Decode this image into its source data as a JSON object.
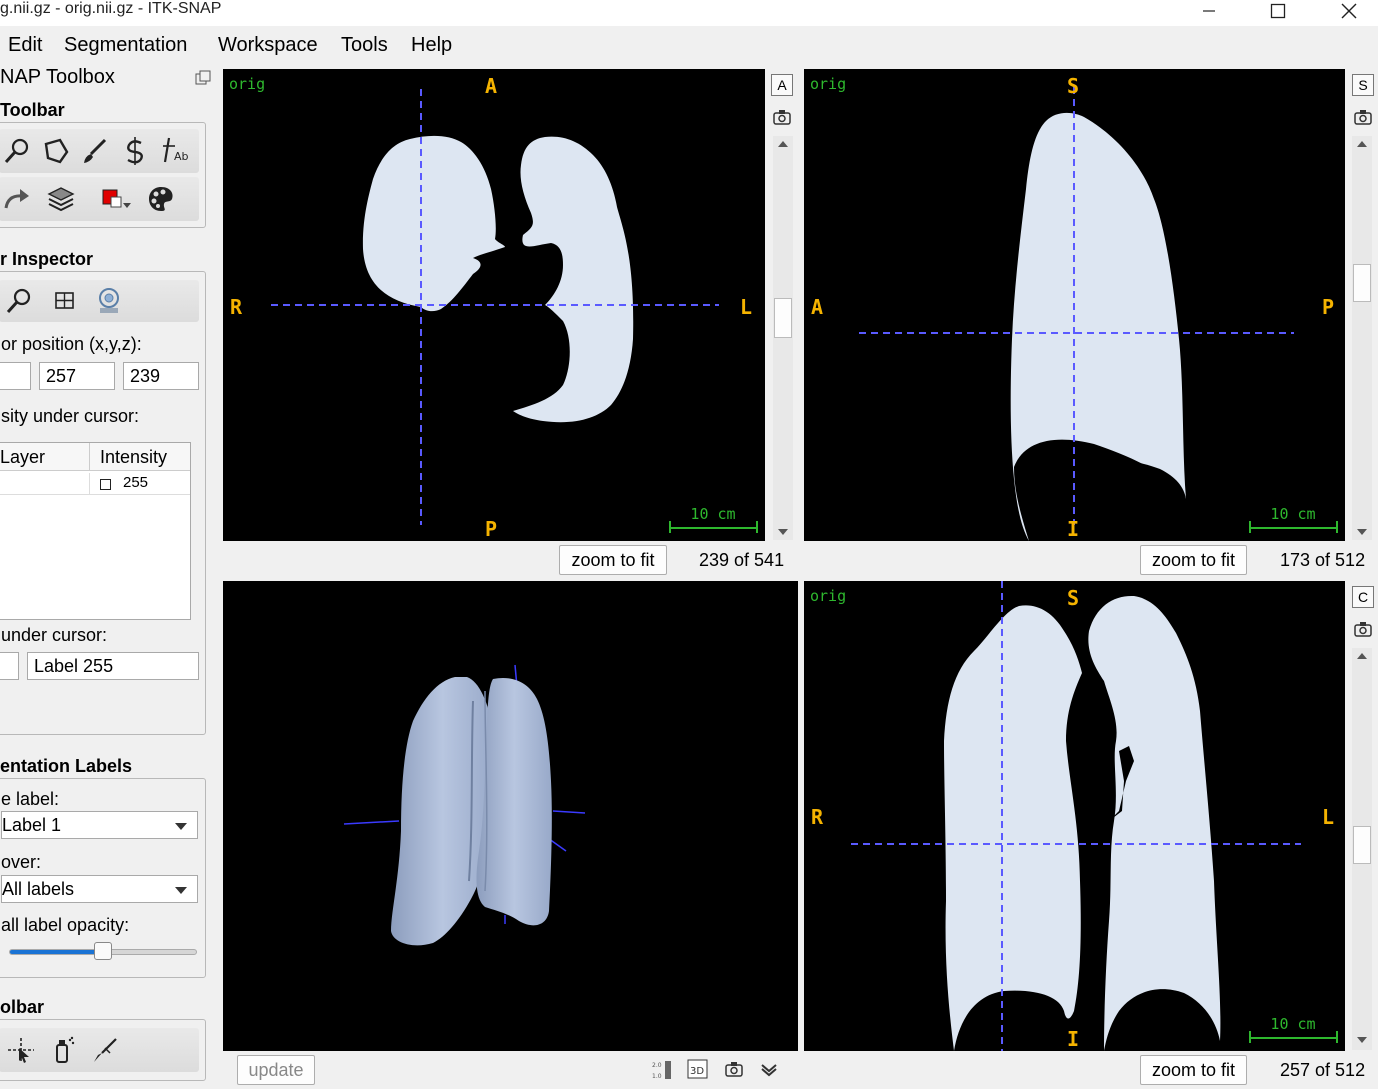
{
  "window": {
    "title": "g.nii.gz - orig.nii.gz - ITK-SNAP"
  },
  "menu": {
    "items": [
      "Edit",
      "Segmentation",
      "Workspace",
      "Tools",
      "Help"
    ]
  },
  "toolbox": {
    "title": "NAP Toolbox",
    "toolbar_title": "Toolbar",
    "inspector_title": "r Inspector",
    "cursor_position_label": "or position (x,y,z):",
    "cursor_y": "257",
    "cursor_z": "239",
    "intensity_label": "sity under cursor:",
    "table": {
      "headers": [
        "Layer",
        "Intensity"
      ],
      "rows": [
        [
          "",
          "255"
        ]
      ]
    },
    "label_under_cursor_label": " under cursor:",
    "label_under_cursor_value": "Label 255",
    "seg_labels_title": "entation Labels",
    "active_label_label": "e label:",
    "active_label_value": "Label 1",
    "paint_over_label": " over:",
    "paint_over_value": "All labels",
    "opacity_label": "all label opacity:",
    "opacity_fraction": 0.5,
    "bottom_toolbar_title": "olbar"
  },
  "views": {
    "axial": {
      "layer": "orig",
      "top": "A",
      "bottom": "P",
      "left": "R",
      "right": "L",
      "scale": "10 cm",
      "side_letter": "A",
      "zoom_label": "zoom to fit",
      "slice": "239 of 541"
    },
    "sagittal": {
      "layer": "orig",
      "top": "S",
      "bottom": "I",
      "left": "A",
      "right": "P",
      "scale": "10 cm",
      "side_letter": "S",
      "zoom_label": "zoom to fit",
      "slice": "173 of 512"
    },
    "coronal": {
      "layer": "orig",
      "top": "S",
      "bottom": "I",
      "left": "R",
      "right": "L",
      "scale": "10 cm",
      "side_letter": "C",
      "zoom_label": "zoom to fit",
      "slice": "257 of 512"
    },
    "render3d": {
      "update_label": "update"
    }
  },
  "colors": {
    "segmentation": "#dde6f2",
    "crosshair": "#5a5aff",
    "orientation": "#f5b300",
    "overlay_text": "#2eb82e",
    "render": "#a9b9d6"
  }
}
